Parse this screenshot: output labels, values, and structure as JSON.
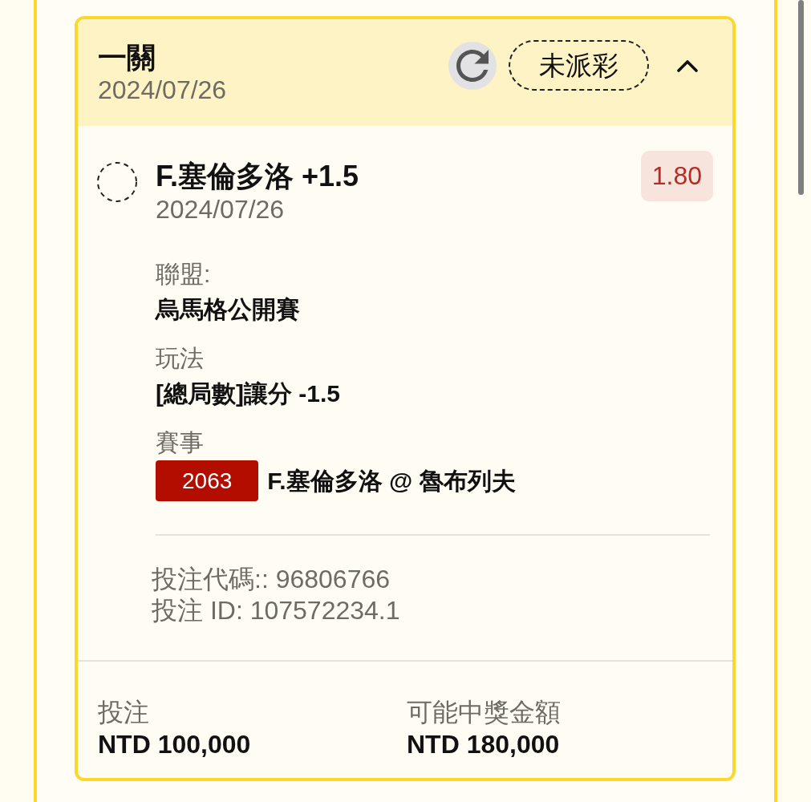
{
  "bet": {
    "type": "一關",
    "date": "2024/07/26",
    "status": "未派彩",
    "expanded": true,
    "selections": [
      {
        "name": "F.塞倫多洛 +1.5",
        "date": "2024/07/26",
        "odds": "1.80",
        "settled": false,
        "details": [
          {
            "kind": "text",
            "label": "聯盟:",
            "value": "烏馬格公開賽"
          },
          {
            "kind": "text",
            "label": "玩法",
            "value": "[總局數]讓分 -1.5"
          },
          {
            "kind": "event",
            "label": "賽事",
            "event_number": "2063",
            "value": "F.塞倫多洛 @ 魯布列夫"
          }
        ]
      }
    ],
    "references": [
      "投注代碼:: 96806766",
      "投注 ID: 107572234.1"
    ],
    "summary": [
      {
        "label": "投注",
        "value": "NTD 100,000"
      },
      {
        "label": "可能中獎金額",
        "value": "NTD 180,000"
      }
    ]
  }
}
